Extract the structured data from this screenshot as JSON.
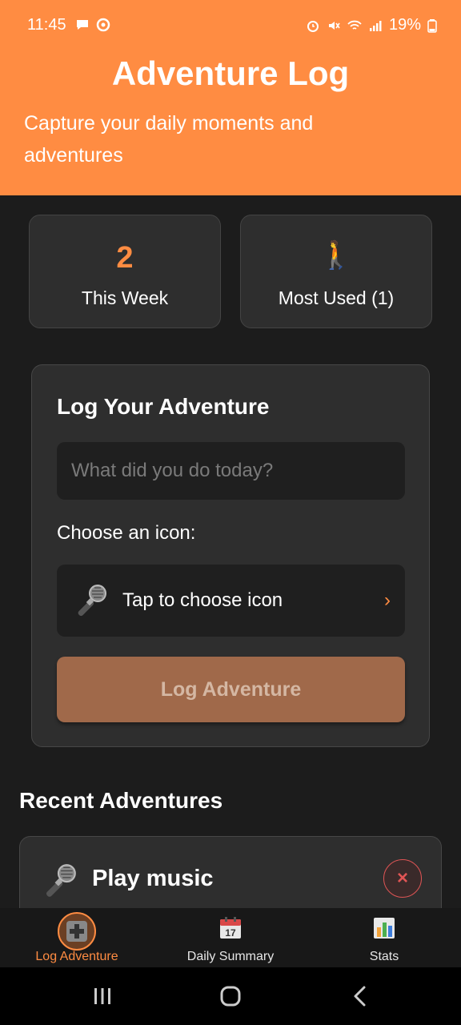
{
  "status_bar": {
    "time": "11:45",
    "battery": "19%",
    "left_icons": [
      "chat-icon",
      "sync-icon"
    ],
    "right_icons": [
      "alarm-icon",
      "mute-icon",
      "wifi-icon",
      "signal-icon",
      "battery-icon"
    ]
  },
  "header": {
    "title": "Adventure Log",
    "subtitle": "Capture your daily moments and adventures",
    "color": "#FF8C42"
  },
  "stats": {
    "this_week_count": "2",
    "this_week_label": "This Week",
    "most_used_icon": "🚶",
    "most_used_label": "Most Used (1)"
  },
  "log_form": {
    "title": "Log Your Adventure",
    "input_value": "",
    "input_placeholder": "What did you do today?",
    "choose_icon_label": "Choose an icon:",
    "icon_picker_text": "Tap to choose icon",
    "icon_picker_chevron": "›",
    "selected_icon": "microphone-icon",
    "submit_label": "Log Adventure"
  },
  "recent": {
    "title": "Recent Adventures",
    "entries": [
      {
        "icon": "microphone-icon",
        "title": "Play music",
        "delete_label": "×"
      }
    ]
  },
  "tabs": [
    {
      "label": "Log Adventure",
      "icon": "plus-icon",
      "active": true
    },
    {
      "label": "Daily Summary",
      "icon": "calendar-icon",
      "calendar_day": "17",
      "active": false
    },
    {
      "label": "Stats",
      "icon": "bar-chart-icon",
      "active": false
    }
  ],
  "colors": {
    "accent": "#FF8C42",
    "background": "#1c1c1c",
    "card": "#2e2e2e",
    "delete": "#e05555"
  }
}
